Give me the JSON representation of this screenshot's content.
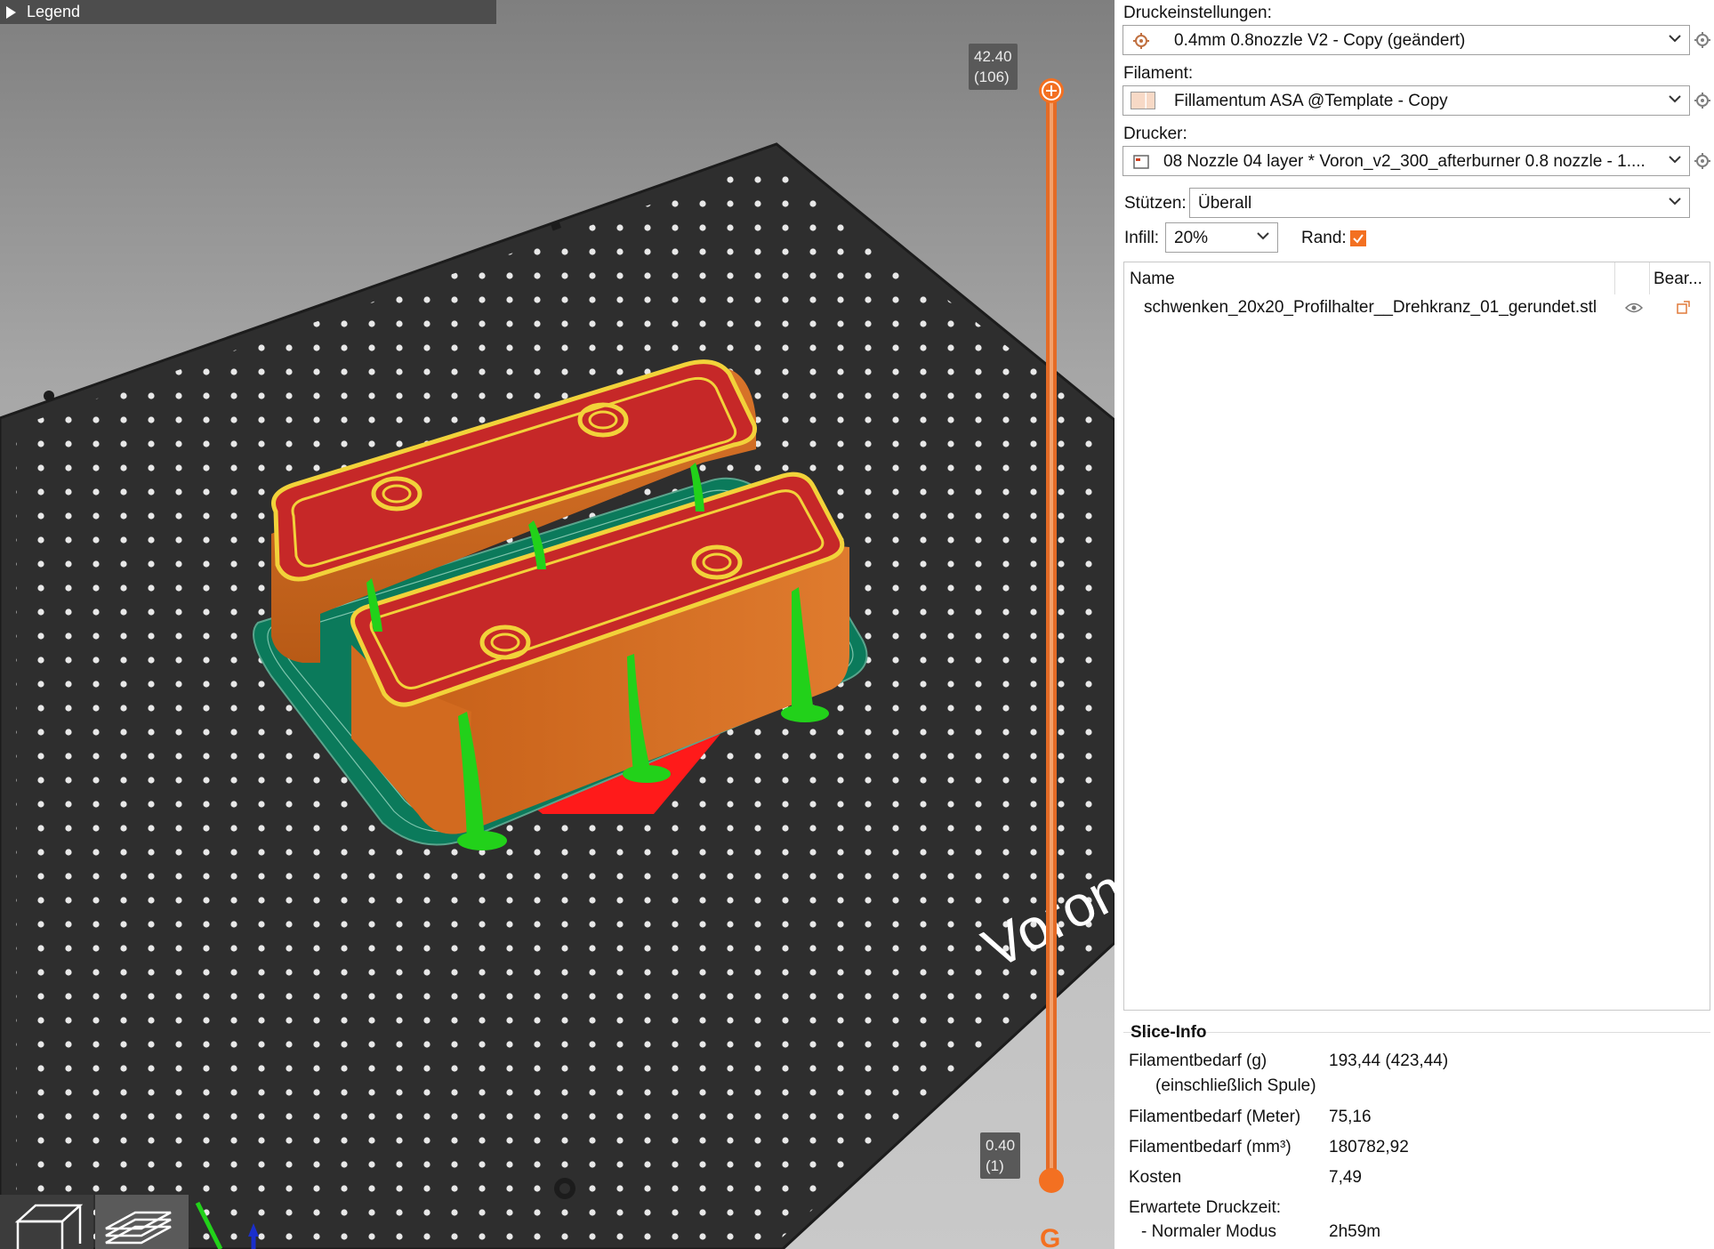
{
  "viewport": {
    "legend_label": "Legend",
    "bed_text": "Voron",
    "slider": {
      "top_height": "42.40",
      "top_layer": "(106)",
      "bottom_height": "0.40",
      "bottom_layer": "(1)",
      "bottom_icon_char": "G"
    },
    "view_buttons": [
      {
        "name": "3d-view",
        "icon": "cube-icon"
      },
      {
        "name": "layer-view",
        "icon": "layers-icon",
        "active": true
      }
    ]
  },
  "panel": {
    "print_settings": {
      "label": "Druckeinstellungen:",
      "value": "0.4mm 0.8nozzle V2 - Copy (geändert)",
      "icon": "gear-icon"
    },
    "filament": {
      "label": "Filament:",
      "value": "Fillamentum ASA @Template - Copy",
      "swatch_color": "#f7d9c6"
    },
    "printer": {
      "label": "Drucker:",
      "value": "08 Nozzle 04 layer * Voron_v2_300_afterburner 0.8 nozzle - 1....",
      "icon": "printer-icon"
    },
    "supports": {
      "label": "Stützen:",
      "value": "Überall"
    },
    "infill": {
      "label": "Infill:",
      "value": "20%"
    },
    "brim": {
      "label": "Rand:",
      "checked": true
    },
    "object_list": {
      "col_name": "Name",
      "col_edit": "Bear...",
      "rows": [
        {
          "name": "schwenken_20x20_Profilhalter__Drehkranz_01_gerundet.stl",
          "visible": true
        }
      ]
    },
    "slice_info": {
      "title": "Slice-Info",
      "rows": [
        {
          "key": "Filamentbedarf (g)",
          "value": "193,44 (423,44)"
        },
        {
          "key": "(einschließlich Spule)",
          "value": ""
        },
        {
          "key": "Filamentbedarf (Meter)",
          "value": "75,16"
        },
        {
          "key": "Filamentbedarf (mm³)",
          "value": "180782,92"
        },
        {
          "key": "Kosten",
          "value": "7,49"
        },
        {
          "key": "Erwartete Druckzeit:",
          "value": ""
        },
        {
          "key": "- Normaler Modus",
          "value": "2h59m"
        }
      ]
    }
  },
  "colors": {
    "accent": "#f37021",
    "bed": "#2d2d2d",
    "model_wall": "#d2691e",
    "model_top": "#c62828",
    "perimeter": "#f2d23a",
    "support": "#22d11a",
    "brim": "#0a7a5a"
  }
}
